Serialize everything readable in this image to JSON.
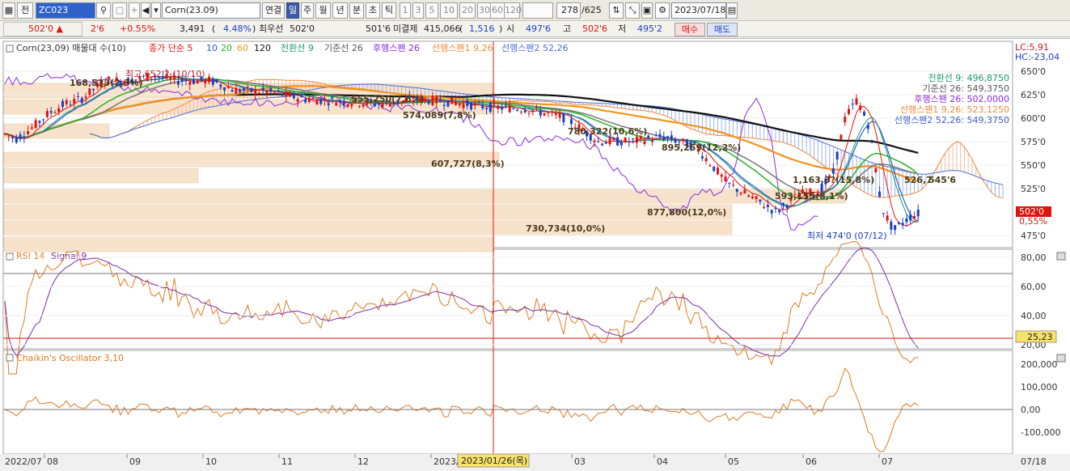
{
  "toolbar": {
    "tb_label": "전",
    "code": "ZC023",
    "name": "Corn(23.09)",
    "link_label": "연결",
    "periods": [
      "일",
      "주",
      "월",
      "년",
      "분",
      "초",
      "틱"
    ],
    "intervals": [
      "1",
      "3",
      "5",
      "10",
      "20",
      "30",
      "60",
      "120"
    ],
    "count": "278",
    "total": "/625",
    "date": "2023/07/18"
  },
  "quote": {
    "price": "502'0",
    "change": "2'6",
    "change_pct": "+0.55%",
    "volume": "3,491",
    "volume_pct": "4.48%",
    "best_label": "최우선",
    "best_value": "502'0",
    "best2": "501'6",
    "oi_label": "미결제",
    "oi_value": "415,066",
    "oi_change": "1,516",
    "open_label": "시",
    "open_value": "497'6",
    "high_label": "고",
    "high_value": "502'6",
    "low_label": "저",
    "low_value": "495'2",
    "buy_label": "매수",
    "sell_label": "매도"
  },
  "legend": {
    "main": "Corn(23,09) 매물대 수(10)",
    "ma_title": "종가 단순 5",
    "ma10": "10",
    "ma20": "20",
    "ma60": "60",
    "ma120": "120",
    "ichi_conv": "전환선 9",
    "ichi_base": "기준선 26",
    "ichi_lag": "후행스팬 26",
    "ichi_lead1": "선행스팬1 9,26",
    "ichi_lead2": "선행스팬2 52,26",
    "rsi": "RSI 14",
    "rsi_signal": "Signal 9",
    "chaikin": "Chaikin's Oscillator 3,10"
  },
  "right_panel": {
    "lc": "LC:5,91",
    "hc": "HC:-23,04",
    "ichi_values": [
      {
        "text": "전환선 9: 496,8750",
        "color": "#1a9a6a"
      },
      {
        "text": "기준선 26: 549,3750",
        "color": "#555555"
      },
      {
        "text": "후행스팬 26: 502,0000",
        "color": "#8a2be2"
      },
      {
        "text": "선행스팬1 9,26: 523,1250",
        "color": "#f08a3c"
      },
      {
        "text": "선행스팬2 52,26: 549,3750",
        "color": "#3b5fd0"
      }
    ],
    "price_label": "502'0",
    "pct_label": "0,55%",
    "rsi_label": "25,23"
  },
  "annotations": {
    "high": "최고 652'2 (10/10)",
    "low": "최저 474'0 (07/12)",
    "vol_profile": [
      "168,533(2,3%)",
      "555,250(7,6%)",
      "574,089(7,8%)",
      "780,322(10,6%)",
      "895,259(12,2%)",
      "607,727(8,3%)",
      "1,163,3?(15,8%)",
      "526,7",
      "593,155(8,1%)",
      "877,800(12,0%)",
      "730,734(10,0%)",
      "545'6"
    ],
    "cursor_date": "2023/01/26(목)"
  },
  "axes": {
    "price_ticks": [
      "650'0",
      "625'0",
      "600'0",
      "575'0",
      "550'0",
      "525'0",
      "475'0"
    ],
    "rsi_ticks": [
      "80,00",
      "60,00",
      "40,00",
      "20,00"
    ],
    "chaikin_ticks": [
      "200,000",
      "100,000",
      "0,00",
      "-100,000"
    ],
    "x_labels": [
      "2022/07",
      "08",
      "09",
      "10",
      "11",
      "12",
      "2023/",
      "03",
      "04",
      "05",
      "06",
      "07",
      "07/18"
    ]
  },
  "colors": {
    "candle_up": "#e0140e",
    "candle_down": "#1b3fc4",
    "ma5": "#e0140e",
    "ma10": "#2a5ad6",
    "ma20": "#28b228",
    "ma60": "#f0941e",
    "ma120": "#111111",
    "conv": "#1a9a6a",
    "base": "#666666",
    "lag": "#8a2be2",
    "lead1": "#f08a3c",
    "lead2": "#4a6fd8",
    "volbar": "#f7e3cc",
    "rsi": "#e07a20",
    "signal": "#7a2fa8"
  }
}
